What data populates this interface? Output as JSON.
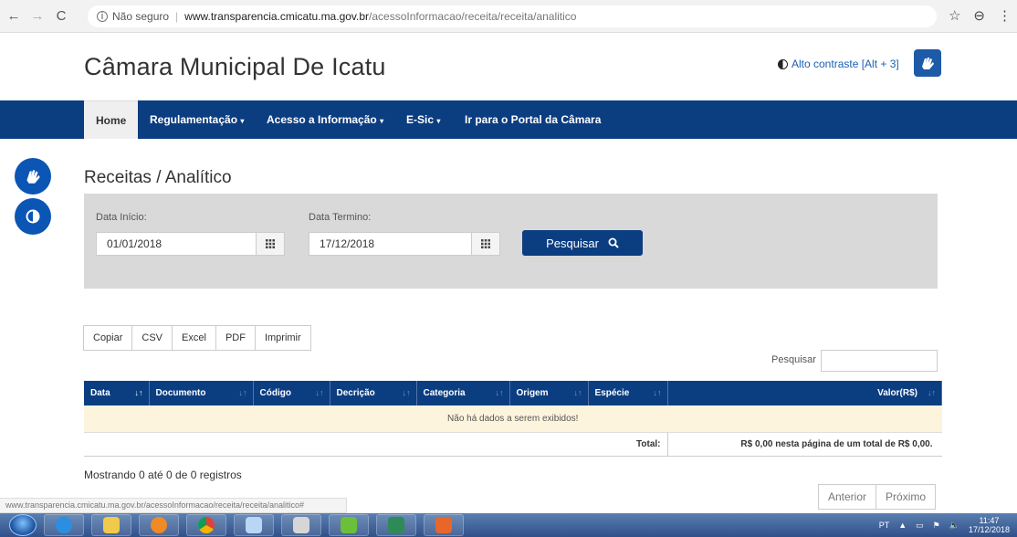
{
  "browser": {
    "back": "←",
    "forward": "→",
    "reload": "C",
    "security_label": "Não seguro",
    "url_host": "www.transparencia.cmicatu.ma.gov.br",
    "url_path": "/acessoInformacao/receita/receita/analitico",
    "star": "☆",
    "profile": "⊖",
    "menu": "⋮"
  },
  "header": {
    "title": "Câmara Municipal De Icatu",
    "contrast_link": "Alto contraste [Alt + 3]"
  },
  "nav": {
    "home": "Home",
    "regulamentacao": "Regulamentação",
    "acesso": "Acesso a Informação",
    "esic": "E-Sic",
    "portal": "Ir para o Portal da Câmara"
  },
  "page": {
    "title": "Receitas / Analítico"
  },
  "filters": {
    "start_label": "Data Início:",
    "start_value": "01/01/2018",
    "end_label": "Data Termino:",
    "end_value": "17/12/2018",
    "search_button": "Pesquisar"
  },
  "export_buttons": [
    "Copiar",
    "CSV",
    "Excel",
    "PDF",
    "Imprimir"
  ],
  "table": {
    "search_label": "Pesquisar",
    "columns": [
      "Data",
      "Documento",
      "Código",
      "Decrição",
      "Categoria",
      "Origem",
      "Espécie",
      "Valor(R$)"
    ],
    "empty_message": "Não há dados a serem exibidos!",
    "total_label": "Total:",
    "total_value": "R$ 0,00 nesta página de um total de R$ 0,00."
  },
  "pagination": {
    "info": "Mostrando 0 até 0 de 0 registros",
    "previous": "Anterior",
    "next": "Próximo"
  },
  "status_bar_url": "www.transparencia.cmicatu.ma.gov.br/acessoInformacao/receita/receita/analitico#",
  "taskbar": {
    "lang": "PT",
    "time": "11:47",
    "date": "17/12/2018"
  },
  "colors": {
    "navbar": "#0b3d81",
    "table_header": "#0b3d81",
    "empty_row": "#fcf4dd",
    "panel": "#d9d9d9"
  }
}
